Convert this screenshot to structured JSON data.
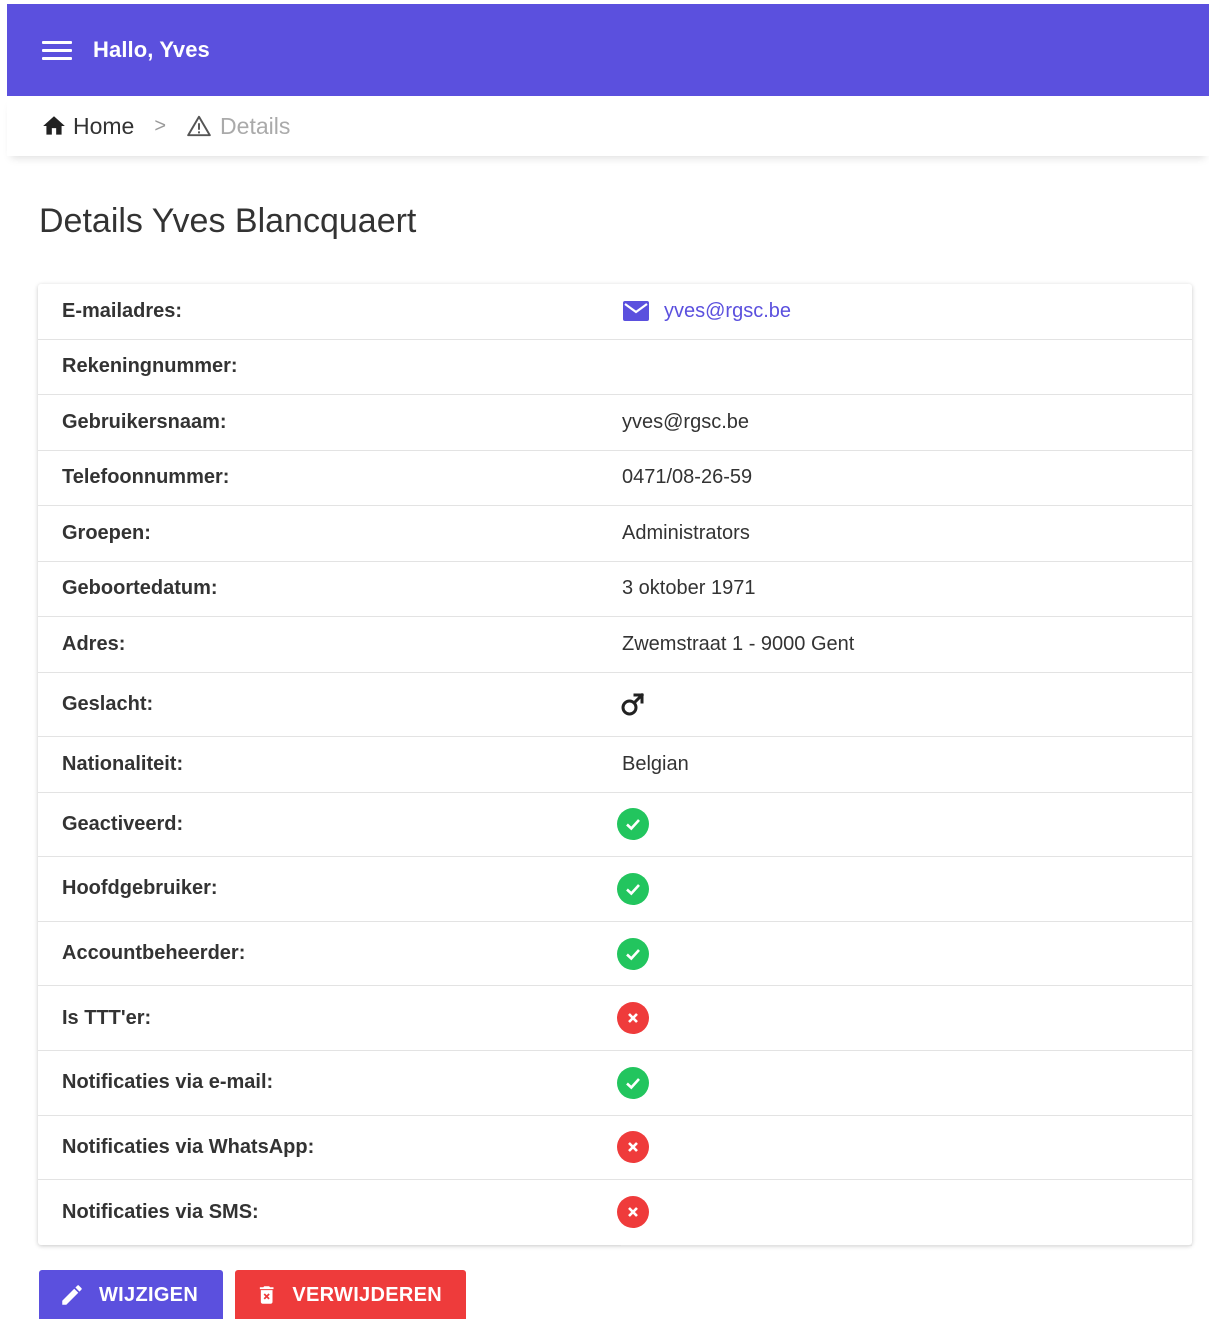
{
  "header": {
    "greeting": "Hallo, Yves",
    "menu_icon": "menu-icon"
  },
  "breadcrumbs": {
    "home": {
      "label": "Home",
      "icon": "home-icon"
    },
    "separator": ">",
    "current": {
      "label": "Details",
      "icon": "warning-icon"
    }
  },
  "page": {
    "title": "Details Yves Blancquaert"
  },
  "details": {
    "email": {
      "label": "E-mailadres:",
      "value": "yves@rgsc.be",
      "icon": "mail-icon"
    },
    "account": {
      "label": "Rekeningnummer:",
      "value": ""
    },
    "username": {
      "label": "Gebruikersnaam:",
      "value": "yves@rgsc.be"
    },
    "phone": {
      "label": "Telefoonnummer:",
      "value": "0471/08-26-59"
    },
    "groups": {
      "label": "Groepen:",
      "value": "Administrators"
    },
    "birthdate": {
      "label": "Geboortedatum:",
      "value": "3 oktober 1971"
    },
    "address": {
      "label": "Adres:",
      "value": "Zwemstraat 1 - 9000 Gent"
    },
    "gender": {
      "label": "Geslacht:",
      "icon": "male-icon"
    },
    "nationality": {
      "label": "Nationaliteit:",
      "value": "Belgian"
    },
    "activated": {
      "label": "Geactiveerd:",
      "status": true
    },
    "main_user": {
      "label": "Hoofdgebruiker:",
      "status": true
    },
    "account_manager": {
      "label": "Accountbeheerder:",
      "status": true
    },
    "ttt": {
      "label": "Is TTT'er:",
      "status": false
    },
    "notify_email": {
      "label": "Notificaties via e-mail:",
      "status": true
    },
    "notify_whatsapp": {
      "label": "Notificaties via WhatsApp:",
      "status": false
    },
    "notify_sms": {
      "label": "Notificaties via SMS:",
      "status": false
    }
  },
  "actions": {
    "edit": {
      "label": "WIJZIGEN",
      "icon": "pencil-icon"
    },
    "delete": {
      "label": "VERWIJDEREN",
      "icon": "trash-icon"
    }
  },
  "colors": {
    "primary": "#5b50de",
    "danger": "#ee3b3b",
    "success": "#22c55e"
  }
}
